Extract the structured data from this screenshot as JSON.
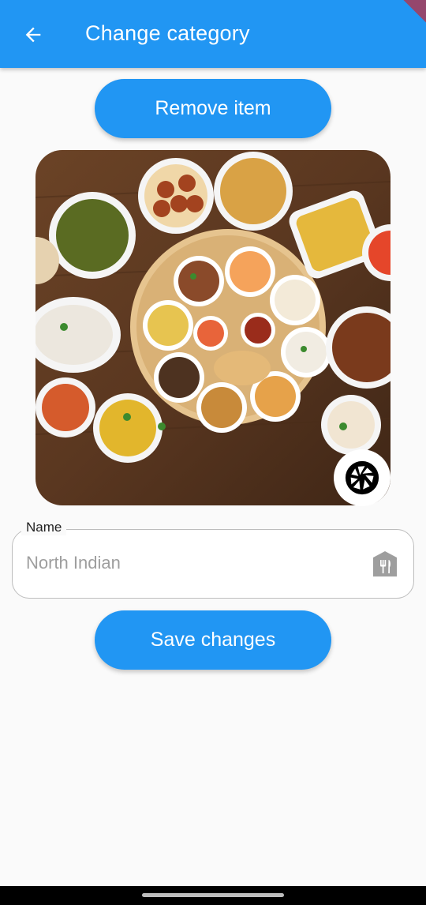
{
  "app_bar": {
    "title": "Change category",
    "back_icon": "arrow-back-icon",
    "color": "#2196f3"
  },
  "actions": {
    "remove_label": "Remove item",
    "save_label": "Save changes"
  },
  "photo": {
    "description_icon": "food-thali-image",
    "camera_icon": "camera-shutter-icon"
  },
  "name_field": {
    "label": "Name",
    "value": "",
    "placeholder": "North Indian",
    "icon": "restaurant-icon"
  },
  "colors": {
    "primary": "#2196f3",
    "background": "#fafafa"
  }
}
